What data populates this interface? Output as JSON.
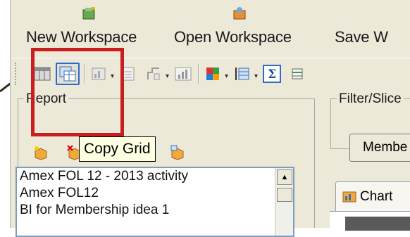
{
  "workspace_bar": {
    "new_workspace": "New Workspace",
    "open_workspace": "Open Workspace",
    "save_workspace": "Save W"
  },
  "toolbar": {
    "icons": [
      "table-icon",
      "copy-grid-icon",
      "chart-icon",
      "list-icon",
      "pivot-icon",
      "bar-chart-icon",
      "color-icon",
      "row-height-icon",
      "sigma-icon",
      "more-icon"
    ]
  },
  "tooltip": {
    "text": "Copy Grid"
  },
  "report_panel": {
    "title": "Report",
    "items": [
      "Amex FOL 12 - 2013 activity",
      "Amex FOL12",
      "BI for Membership idea 1"
    ]
  },
  "filter_panel": {
    "title": "Filter/Slice",
    "member_button": "Membe"
  },
  "chart_tab": {
    "label": "Chart"
  },
  "colors": {
    "highlight": "#c81e1e",
    "pressed_border": "#316ac5",
    "tooltip_bg": "#ffffe1"
  }
}
